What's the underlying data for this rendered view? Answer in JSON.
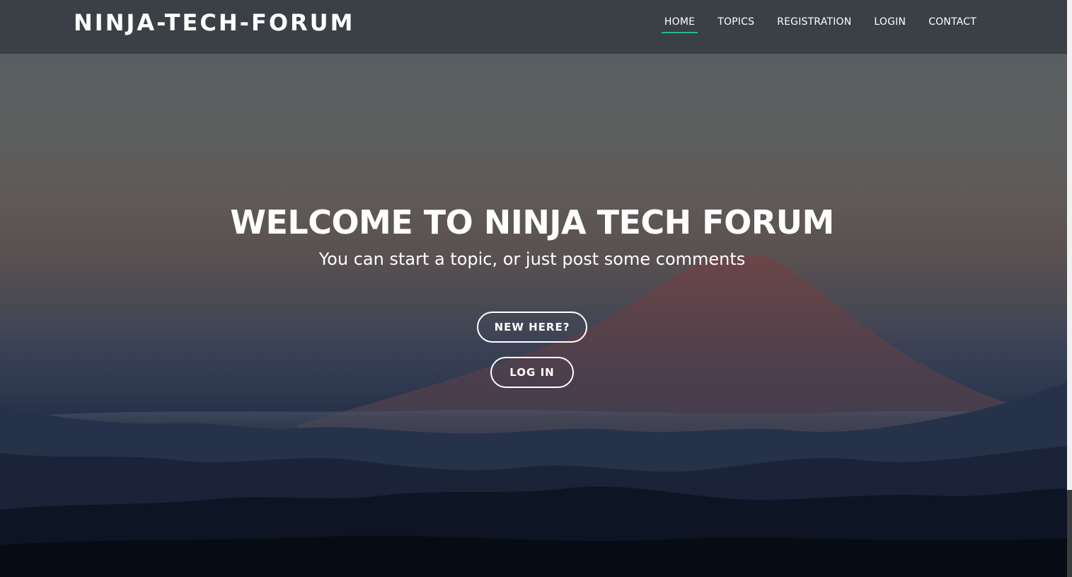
{
  "header": {
    "brand": "NINJA-TECH-FORUM"
  },
  "nav": {
    "items": [
      {
        "label": "HOME",
        "active": true
      },
      {
        "label": "TOPICS",
        "active": false
      },
      {
        "label": "REGISTRATION",
        "active": false
      },
      {
        "label": "LOGIN",
        "active": false
      },
      {
        "label": "CONTACT",
        "active": false
      }
    ]
  },
  "hero": {
    "title": "WELCOME TO NINJA TECH FORUM",
    "subtitle": "You can start a topic, or just post some comments",
    "primary_button": "NEW HERE?",
    "secondary_button": "LOG IN"
  },
  "colors": {
    "navbar": "#3a4045",
    "accent": "#27b68c",
    "text": "#ffffff"
  }
}
